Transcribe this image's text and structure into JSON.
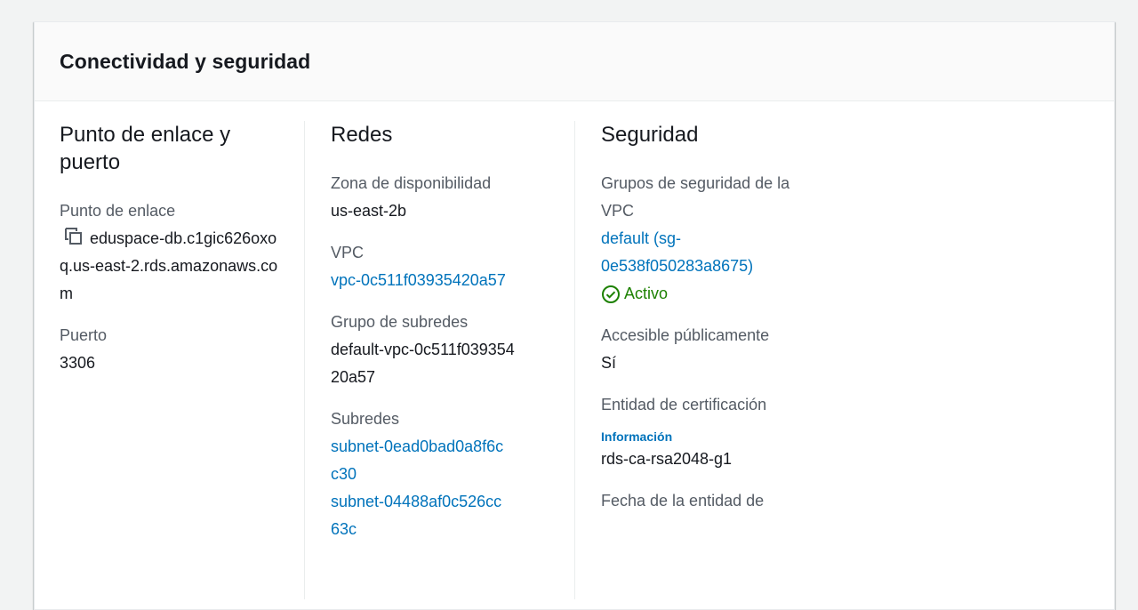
{
  "panel": {
    "title": "Conectividad y seguridad"
  },
  "endpoint_section": {
    "heading": "Punto de enlace y puerto",
    "endpoint_label": "Punto de enlace",
    "endpoint_value": "eduspace-db.c1gic626oxoq.us-east-2.rds.amazonaws.com",
    "copy_icon": "copy-icon",
    "port_label": "Puerto",
    "port_value": "3306"
  },
  "network_section": {
    "heading": "Redes",
    "az_label": "Zona de disponibilidad",
    "az_value": "us-east-2b",
    "vpc_label": "VPC",
    "vpc_value": "vpc-0c511f03935420a57",
    "subnet_group_label": "Grupo de subredes",
    "subnet_group_value": "default-vpc-0c511f03935420a57",
    "subnets_label": "Subredes",
    "subnets": [
      "subnet-0ead0bad0a8f6cc30",
      "subnet-04488af0c526cc63c"
    ]
  },
  "security_section": {
    "heading": "Seguridad",
    "sg_label": "Grupos de seguridad de la VPC",
    "sg_value": "default (sg-0e538f050283a8675)",
    "sg_status": "Activo",
    "sg_status_icon": "check-circle-icon",
    "public_label": "Accesible públicamente",
    "public_value": "Sí",
    "ca_label": "Entidad de certificación",
    "ca_info_link": "Información",
    "ca_value": "rds-ca-rsa2048-g1",
    "ca_date_label": "Fecha de la entidad de"
  },
  "colors": {
    "link": "#0073bb",
    "status_active": "#1d8102",
    "label": "#545b64"
  }
}
